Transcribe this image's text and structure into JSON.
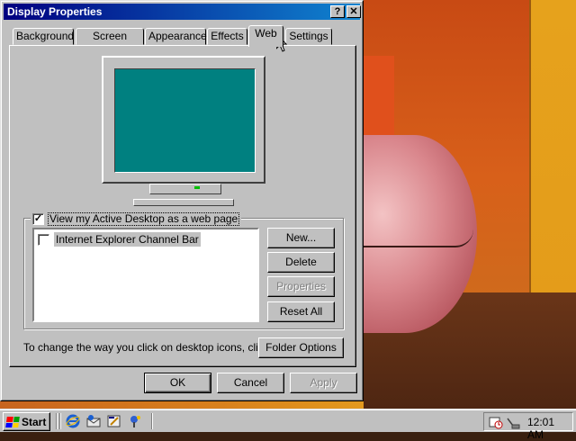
{
  "dialog": {
    "title": "Display Properties",
    "help_button": "?",
    "close_button": "✕",
    "tabs": [
      {
        "label": "Background"
      },
      {
        "label": "Screen Saver"
      },
      {
        "label": "Appearance"
      },
      {
        "label": "Effects"
      },
      {
        "label": "Web"
      },
      {
        "label": "Settings"
      }
    ],
    "active_tab": "Web",
    "preview_screen_color": "#008080",
    "active_desktop": {
      "checkbox_label": "View my Active Desktop as a web page",
      "checked": true,
      "checkmark": "✓",
      "items": [
        {
          "label": "Internet Explorer Channel Bar",
          "checked": false
        }
      ]
    },
    "side_buttons": {
      "new": "New...",
      "delete": "Delete",
      "properties": "Properties",
      "reset_all": "Reset All"
    },
    "hint_text": "To change the way you click on desktop icons, click:",
    "folder_options": "Folder Options",
    "footer": {
      "ok": "OK",
      "cancel": "Cancel",
      "apply": "Apply"
    }
  },
  "taskbar": {
    "start_label": "Start",
    "quick_launch": [
      "internet-explorer-icon",
      "outlook-express-icon",
      "show-desktop-icon",
      "channels-icon"
    ],
    "clock": "12:01 AM"
  }
}
